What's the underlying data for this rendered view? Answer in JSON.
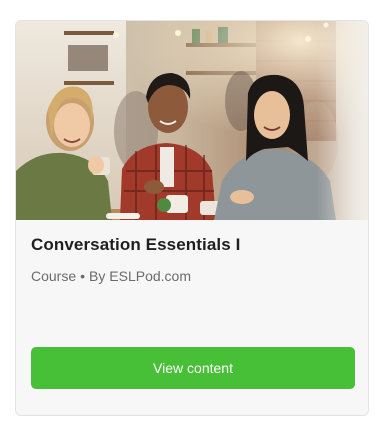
{
  "card": {
    "image_alt": "Three friends chatting over coffee in a café",
    "title": "Conversation Essentials I",
    "meta": {
      "type": "Course",
      "separator": "•",
      "author": "By ESLPod.com"
    },
    "cta_label": "View content",
    "accent_color": "#47bf36"
  }
}
